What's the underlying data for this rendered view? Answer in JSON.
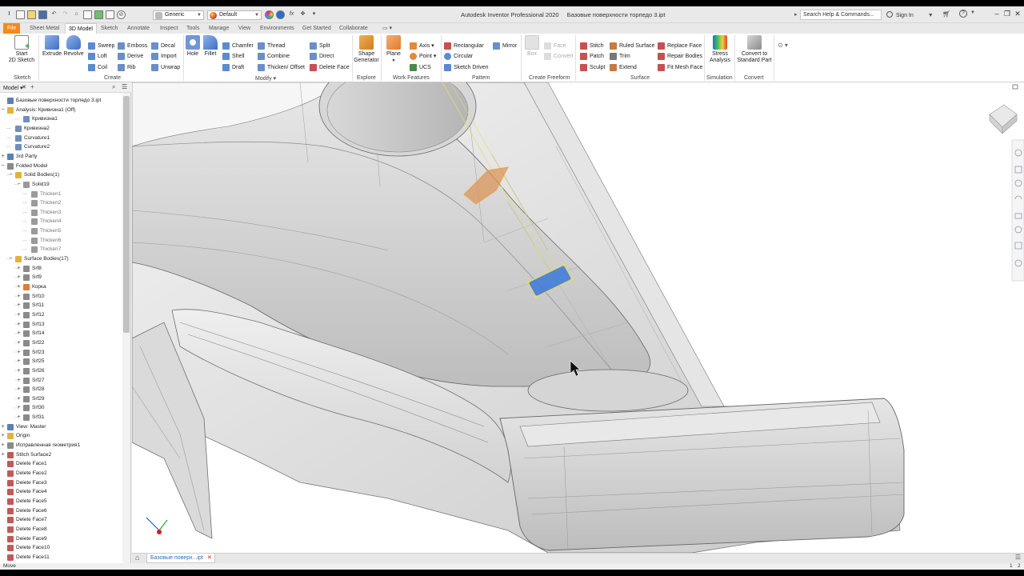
{
  "titlebar": {
    "app_title": "Autodesk Inventor Professional 2020",
    "document_title": "Базовые поверхности торпедо 3.ipt",
    "material": "Generic",
    "appearance": "Default",
    "search_placeholder": "Search Help & Commands...",
    "sign_in": "Sign In"
  },
  "tabs": [
    {
      "label": "File"
    },
    {
      "label": "Sheet Metal"
    },
    {
      "label": "3D Model"
    },
    {
      "label": "Sketch"
    },
    {
      "label": "Annotate"
    },
    {
      "label": "Inspect"
    },
    {
      "label": "Tools"
    },
    {
      "label": "Manage"
    },
    {
      "label": "View"
    },
    {
      "label": "Environments"
    },
    {
      "label": "Get Started"
    },
    {
      "label": "Collaborate"
    }
  ],
  "ribbon": {
    "sketch": {
      "start_line1": "Start",
      "start_line2": "2D Sketch",
      "panel": "Sketch"
    },
    "create": {
      "extrude": "Extrude",
      "revolve": "Revolve",
      "sweep": "Sweep",
      "emboss": "Emboss",
      "decal": "Decal",
      "loft": "Loft",
      "derive": "Derive",
      "import": "Import",
      "coil": "Coil",
      "rib": "Rib",
      "unwrap": "Unwrap",
      "panel": "Create"
    },
    "modify": {
      "hole": "Hole",
      "fillet": "Fillet",
      "chamfer": "Chamfer",
      "thread": "Thread",
      "split": "Split",
      "shell": "Shell",
      "combine": "Combine",
      "direct": "Direct",
      "draft": "Draft",
      "thicken": "Thicken/ Offset",
      "delete_face": "Delete Face",
      "panel": "Modify"
    },
    "explore": {
      "shape_line1": "Shape",
      "shape_line2": "Generator",
      "panel": "Explore"
    },
    "work": {
      "plane": "Plane",
      "axis": "Axis",
      "point": "Point",
      "ucs": "UCS",
      "panel": "Work Features"
    },
    "pattern": {
      "rectangular": "Rectangular",
      "mirror": "Mirror",
      "circular": "Circular",
      "sketch_driven": "Sketch Driven",
      "panel": "Pattern"
    },
    "freeform": {
      "box": "Box",
      "face": "Face",
      "convert": "Convert",
      "panel": "Create Freeform"
    },
    "surface": {
      "stitch": "Stitch",
      "ruled": "Ruled Surface",
      "replace": "Replace Face",
      "patch": "Patch",
      "trim": "Trim",
      "repair": "Repair Bodies",
      "sculpt": "Sculpt",
      "extend": "Extend",
      "fit_mesh": "Fit Mesh Face",
      "panel": "Surface"
    },
    "simulation": {
      "line1": "Stress",
      "line2": "Analysis",
      "panel": "Simulation"
    },
    "convert": {
      "line1": "Convert to",
      "line2": "Standard Part",
      "panel": "Convert"
    }
  },
  "browser": {
    "title": "Model",
    "items": [
      {
        "label": "Базовые поверхности торпедо 3.ipt",
        "level": 0,
        "toggle": "",
        "color": "#5a7fb5"
      },
      {
        "label": "Analysis: Кривизна1 (Off)",
        "level": 0,
        "toggle": "−",
        "color": "#e2b33a"
      },
      {
        "label": "Кривизна1",
        "level": 2,
        "toggle": "",
        "color": "#6f8fbf"
      },
      {
        "label": "Кривизна2",
        "level": 1,
        "toggle": "",
        "color": "#6f8fbf"
      },
      {
        "label": "Curvature1",
        "level": 1,
        "toggle": "",
        "color": "#6f8fbf"
      },
      {
        "label": "Curvature2",
        "level": 1,
        "toggle": "",
        "color": "#6f8fbf"
      },
      {
        "label": "3rd Party",
        "level": 0,
        "toggle": "+",
        "color": "#5a7fb5"
      },
      {
        "label": "Folded Model",
        "level": 0,
        "toggle": "−",
        "color": "#8a8a8a"
      },
      {
        "label": "Solid Bodies(1)",
        "level": 1,
        "toggle": "−",
        "color": "#e2b33a"
      },
      {
        "label": "Solid19",
        "level": 2,
        "toggle": "−",
        "color": "#9a9a9a"
      },
      {
        "label": "Thicken1",
        "level": 3,
        "toggle": "",
        "color": "#9a9a9a",
        "dim": true
      },
      {
        "label": "Thicken2",
        "level": 3,
        "toggle": "",
        "color": "#9a9a9a",
        "dim": true
      },
      {
        "label": "Thicken3",
        "level": 3,
        "toggle": "",
        "color": "#9a9a9a",
        "dim": true
      },
      {
        "label": "Thicken4",
        "level": 3,
        "toggle": "",
        "color": "#9a9a9a",
        "dim": true
      },
      {
        "label": "Thicken5",
        "level": 3,
        "toggle": "",
        "color": "#9a9a9a",
        "dim": true
      },
      {
        "label": "Thicken6",
        "level": 3,
        "toggle": "",
        "color": "#9a9a9a",
        "dim": true
      },
      {
        "label": "Thicken7",
        "level": 3,
        "toggle": "",
        "color": "#9a9a9a",
        "dim": true
      },
      {
        "label": "Surface Bodies(17)",
        "level": 1,
        "toggle": "−",
        "color": "#e2b33a"
      },
      {
        "label": "Srf8",
        "level": 2,
        "toggle": "+",
        "color": "#8a8a8a"
      },
      {
        "label": "Srf9",
        "level": 2,
        "toggle": "+",
        "color": "#8a8a8a"
      },
      {
        "label": "Корка",
        "level": 2,
        "toggle": "+",
        "color": "#e07a3a"
      },
      {
        "label": "Srf10",
        "level": 2,
        "toggle": "+",
        "color": "#8a8a8a"
      },
      {
        "label": "Srf11",
        "level": 2,
        "toggle": "+",
        "color": "#8a8a8a"
      },
      {
        "label": "Srf12",
        "level": 2,
        "toggle": "+",
        "color": "#8a8a8a"
      },
      {
        "label": "Srf13",
        "level": 2,
        "toggle": "+",
        "color": "#8a8a8a"
      },
      {
        "label": "Srf14",
        "level": 2,
        "toggle": "+",
        "color": "#8a8a8a"
      },
      {
        "label": "Srf22",
        "level": 2,
        "toggle": "+",
        "color": "#8a8a8a"
      },
      {
        "label": "Srf23",
        "level": 2,
        "toggle": "+",
        "color": "#8a8a8a"
      },
      {
        "label": "Srf25",
        "level": 2,
        "toggle": "+",
        "color": "#8a8a8a"
      },
      {
        "label": "Srf26",
        "level": 2,
        "toggle": "+",
        "color": "#8a8a8a"
      },
      {
        "label": "Srf27",
        "level": 2,
        "toggle": "+",
        "color": "#8a8a8a"
      },
      {
        "label": "Srf28",
        "level": 2,
        "toggle": "+",
        "color": "#8a8a8a"
      },
      {
        "label": "Srf29",
        "level": 2,
        "toggle": "+",
        "color": "#8a8a8a"
      },
      {
        "label": "Srf30",
        "level": 2,
        "toggle": "+",
        "color": "#8a8a8a"
      },
      {
        "label": "Srf31",
        "level": 2,
        "toggle": "+",
        "color": "#8a8a8a"
      },
      {
        "label": "View: Master",
        "level": 0,
        "toggle": "+",
        "color": "#5a7fb5"
      },
      {
        "label": "Origin",
        "level": 0,
        "toggle": "+",
        "color": "#e2b33a"
      },
      {
        "label": "Исправленная геометрия1",
        "level": 0,
        "toggle": "+",
        "color": "#8a8a8a"
      },
      {
        "label": "Stitch Surface2",
        "level": 0,
        "toggle": "+",
        "color": "#c05a5a"
      },
      {
        "label": "Delete Face1",
        "level": 0,
        "toggle": "",
        "color": "#c05a5a"
      },
      {
        "label": "Delete Face2",
        "level": 0,
        "toggle": "",
        "color": "#c05a5a"
      },
      {
        "label": "Delete Face3",
        "level": 0,
        "toggle": "",
        "color": "#c05a5a"
      },
      {
        "label": "Delete Face4",
        "level": 0,
        "toggle": "",
        "color": "#c05a5a"
      },
      {
        "label": "Delete Face5",
        "level": 0,
        "toggle": "",
        "color": "#c05a5a"
      },
      {
        "label": "Delete Face6",
        "level": 0,
        "toggle": "",
        "color": "#c05a5a"
      },
      {
        "label": "Delete Face7",
        "level": 0,
        "toggle": "",
        "color": "#c05a5a"
      },
      {
        "label": "Delete Face8",
        "level": 0,
        "toggle": "",
        "color": "#c05a5a"
      },
      {
        "label": "Delete Face9",
        "level": 0,
        "toggle": "",
        "color": "#c05a5a"
      },
      {
        "label": "Delete Face10",
        "level": 0,
        "toggle": "",
        "color": "#c05a5a"
      },
      {
        "label": "Delete Face11",
        "level": 0,
        "toggle": "",
        "color": "#c05a5a"
      }
    ]
  },
  "doc_tab": {
    "label": "Базовые поверх...ipt"
  },
  "status": {
    "left": "Move",
    "count1": "1",
    "count2": "2"
  },
  "colors": {
    "accent": "#f48a1a",
    "selection_blue": "#3a78d8",
    "selection_orange": "#e9a24a"
  }
}
